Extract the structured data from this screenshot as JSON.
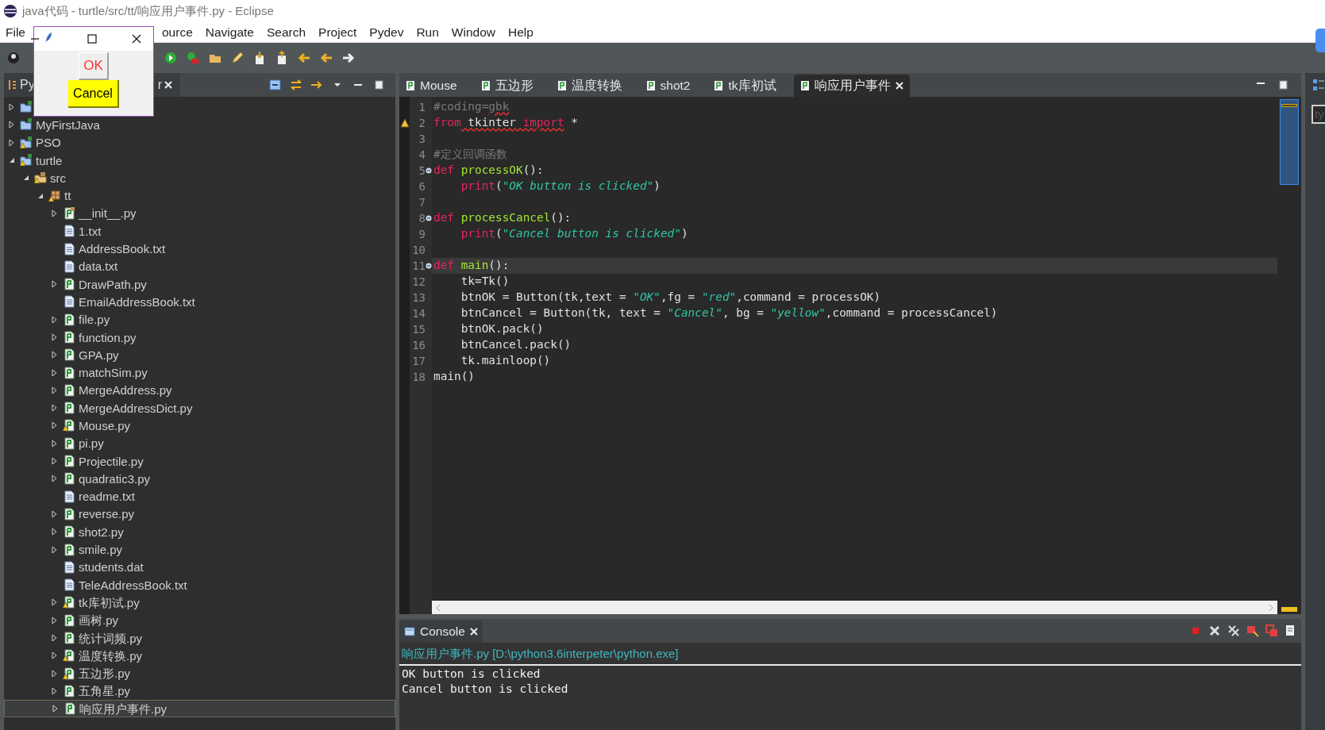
{
  "window": {
    "title": "java代码 - turtle/src/tt/响应用户事件.py - Eclipse"
  },
  "menu": [
    "File",
    "ource",
    "Navigate",
    "Search",
    "Project",
    "Pydev",
    "Run",
    "Window",
    "Help"
  ],
  "explorer": {
    "title_start": "Py",
    "title_end": "r",
    "tree": [
      {
        "kind": "project",
        "expanded": false
      },
      {
        "label": "MyFirstJava",
        "kind": "project",
        "expanded": false
      },
      {
        "label": "PSO",
        "kind": "project-warn",
        "expanded": false
      },
      {
        "label": "turtle",
        "kind": "project-warn",
        "expanded": true,
        "children": [
          {
            "label": "src",
            "kind": "source-warn",
            "expanded": true,
            "children": [
              {
                "label": "tt",
                "kind": "package-warn",
                "expanded": true,
                "children": [
                  {
                    "label": "__init__.py",
                    "kind": "init",
                    "expanded": false
                  },
                  {
                    "label": "1.txt",
                    "kind": "text"
                  },
                  {
                    "label": "AddressBook.txt",
                    "kind": "text"
                  },
                  {
                    "label": "data.txt",
                    "kind": "text"
                  },
                  {
                    "label": "DrawPath.py",
                    "kind": "python",
                    "expanded": false
                  },
                  {
                    "label": "EmailAddressBook.txt",
                    "kind": "text"
                  },
                  {
                    "label": "file.py",
                    "kind": "python",
                    "expanded": false
                  },
                  {
                    "label": "function.py",
                    "kind": "python",
                    "expanded": false
                  },
                  {
                    "label": "GPA.py",
                    "kind": "python",
                    "expanded": false
                  },
                  {
                    "label": "matchSim.py",
                    "kind": "python",
                    "expanded": false
                  },
                  {
                    "label": "MergeAddress.py",
                    "kind": "python",
                    "expanded": false
                  },
                  {
                    "label": "MergeAddressDict.py",
                    "kind": "python",
                    "expanded": false
                  },
                  {
                    "label": "Mouse.py",
                    "kind": "python-warn",
                    "expanded": false
                  },
                  {
                    "label": "pi.py",
                    "kind": "python",
                    "expanded": false
                  },
                  {
                    "label": "Projectile.py",
                    "kind": "python",
                    "expanded": false
                  },
                  {
                    "label": "quadratic3.py",
                    "kind": "python",
                    "expanded": false
                  },
                  {
                    "label": "readme.txt",
                    "kind": "text"
                  },
                  {
                    "label": "reverse.py",
                    "kind": "python",
                    "expanded": false
                  },
                  {
                    "label": "shot2.py",
                    "kind": "python",
                    "expanded": false
                  },
                  {
                    "label": "smile.py",
                    "kind": "python",
                    "expanded": false
                  },
                  {
                    "label": "students.dat",
                    "kind": "text"
                  },
                  {
                    "label": "TeleAddressBook.txt",
                    "kind": "text"
                  },
                  {
                    "label": "tk库初试.py",
                    "kind": "python-warn",
                    "expanded": false
                  },
                  {
                    "label": "画树.py",
                    "kind": "python",
                    "expanded": false
                  },
                  {
                    "label": "统计词频.py",
                    "kind": "python",
                    "expanded": false
                  },
                  {
                    "label": "温度转换.py",
                    "kind": "python-warn",
                    "expanded": false
                  },
                  {
                    "label": "五边形.py",
                    "kind": "python-warn",
                    "expanded": false
                  },
                  {
                    "label": "五角星.py",
                    "kind": "python",
                    "expanded": false
                  },
                  {
                    "label": "响应用户事件.py",
                    "kind": "python",
                    "expanded": false,
                    "selected": true
                  }
                ]
              }
            ]
          }
        ]
      }
    ]
  },
  "editor": {
    "tabs": [
      {
        "label": "Mouse",
        "selected": false
      },
      {
        "label": "五边形",
        "selected": false
      },
      {
        "label": "温度转换",
        "selected": false
      },
      {
        "label": "shot2",
        "selected": false
      },
      {
        "label": "tk库初试",
        "selected": false
      },
      {
        "label": "响应用户事件",
        "selected": true
      }
    ],
    "lines": [
      {
        "n": "1",
        "tokens": [
          {
            "text": "#coding=",
            "kind": "comment"
          },
          {
            "text": "gbk",
            "kind": "comment",
            "squiggle": true
          }
        ]
      },
      {
        "n": "2",
        "warning": true,
        "tokens": [
          {
            "text": "from",
            "kind": "keyword"
          },
          {
            "text": " tkinter",
            "kind": "plain",
            "squiggle": true
          },
          {
            "text": " import",
            "kind": "keyword",
            "squiggle": true
          },
          {
            "text": " *",
            "kind": "plain"
          }
        ]
      },
      {
        "n": "3"
      },
      {
        "n": "4",
        "tokens": [
          {
            "text": "#定义回调函数",
            "kind": "comment"
          }
        ]
      },
      {
        "n": "5",
        "fold": true,
        "tokens": [
          {
            "text": "def",
            "kind": "keyword"
          },
          {
            "text": " processOK",
            "kind": "function"
          },
          {
            "text": "():",
            "kind": "plain"
          }
        ]
      },
      {
        "n": "6",
        "tokens": [
          {
            "text": "    print",
            "kind": "keyword"
          },
          {
            "text": "(",
            "kind": "plain"
          },
          {
            "text": "\"OK button is clicked\"",
            "kind": "string"
          },
          {
            "text": ")",
            "kind": "plain"
          }
        ]
      },
      {
        "n": "7"
      },
      {
        "n": "8",
        "fold": true,
        "tokens": [
          {
            "text": "def",
            "kind": "keyword"
          },
          {
            "text": " processCancel",
            "kind": "function"
          },
          {
            "text": "():",
            "kind": "plain"
          }
        ]
      },
      {
        "n": "9",
        "tokens": [
          {
            "text": "    print",
            "kind": "keyword"
          },
          {
            "text": "(",
            "kind": "plain"
          },
          {
            "text": "\"Cancel button is clicked\"",
            "kind": "string"
          },
          {
            "text": ")",
            "kind": "plain"
          }
        ]
      },
      {
        "n": "10"
      },
      {
        "n": "11",
        "fold": true,
        "current": true,
        "tokens": [
          {
            "text": "def",
            "kind": "keyword"
          },
          {
            "text": " main",
            "kind": "function"
          },
          {
            "text": "():",
            "kind": "plain"
          }
        ]
      },
      {
        "n": "12",
        "tokens": [
          {
            "text": "    tk=Tk()",
            "kind": "plain"
          }
        ]
      },
      {
        "n": "13",
        "tokens": [
          {
            "text": "    btnOK = Button(tk,text = ",
            "kind": "plain"
          },
          {
            "text": "\"OK\"",
            "kind": "string"
          },
          {
            "text": ",fg = ",
            "kind": "plain"
          },
          {
            "text": "\"red\"",
            "kind": "string"
          },
          {
            "text": ",command = processOK)",
            "kind": "plain"
          }
        ]
      },
      {
        "n": "14",
        "tokens": [
          {
            "text": "    btnCancel = Button(tk, text = ",
            "kind": "plain"
          },
          {
            "text": "\"Cancel\"",
            "kind": "string"
          },
          {
            "text": ", bg = ",
            "kind": "plain"
          },
          {
            "text": "\"yellow\"",
            "kind": "string"
          },
          {
            "text": ",command = processCancel)",
            "kind": "plain"
          }
        ]
      },
      {
        "n": "15",
        "tokens": [
          {
            "text": "    btnOK.pack()",
            "kind": "plain"
          }
        ]
      },
      {
        "n": "16",
        "tokens": [
          {
            "text": "    btnCancel.pack()",
            "kind": "plain"
          }
        ]
      },
      {
        "n": "17",
        "tokens": [
          {
            "text": "    tk.mainloop()",
            "kind": "plain"
          }
        ]
      },
      {
        "n": "18",
        "tokens": [
          {
            "text": "main()",
            "kind": "plain"
          }
        ]
      }
    ]
  },
  "console": {
    "tab": "Console",
    "header": "响应用户事件.py [D:\\python3.6interpeter\\python.exe]",
    "output": [
      "OK button is clicked",
      "Cancel button is clicked"
    ]
  },
  "outline": {
    "placeholder": "ty"
  },
  "tk_window": {
    "buttons": [
      {
        "label": "OK",
        "kind": "ok"
      },
      {
        "label": "Cancel",
        "kind": "cancel"
      }
    ]
  }
}
